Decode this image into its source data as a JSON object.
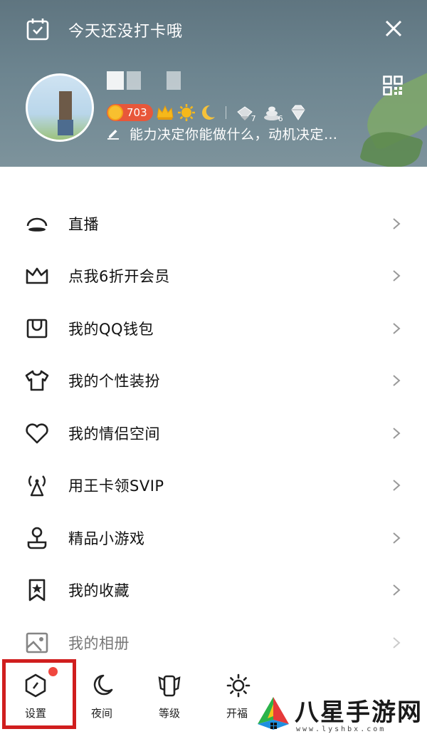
{
  "header": {
    "checkin_text": "今天还没打卡哦",
    "level_number": "703",
    "signature": "能力决定你能做什么，动机决定…",
    "badge_counts": [
      "7",
      "6"
    ]
  },
  "menu": {
    "items": [
      {
        "label": "直播",
        "icon": "live-icon"
      },
      {
        "label": "点我6折开会员",
        "icon": "crown-icon"
      },
      {
        "label": "我的QQ钱包",
        "icon": "wallet-icon"
      },
      {
        "label": "我的个性装扮",
        "icon": "tshirt-icon"
      },
      {
        "label": "我的情侣空间",
        "icon": "heart-icon"
      },
      {
        "label": "用王卡领SVIP",
        "icon": "signal-tower-icon"
      },
      {
        "label": "精品小游戏",
        "icon": "joystick-icon"
      },
      {
        "label": "我的收藏",
        "icon": "bookmark-star-icon"
      },
      {
        "label": "我的相册",
        "icon": "photo-album-icon"
      }
    ]
  },
  "bottom_bar": {
    "tabs": [
      {
        "label": "设置",
        "icon": "settings-hexagon-icon"
      },
      {
        "label": "夜间",
        "icon": "moon-icon"
      },
      {
        "label": "等级",
        "icon": "level-badge-icon"
      },
      {
        "label": "开福",
        "icon": "sun-icon"
      }
    ]
  },
  "watermark": {
    "title": "八星手游网",
    "url": "www.lyshbx.com"
  },
  "colors": {
    "header_bg": "#6d8590",
    "accent_red": "#f0473f",
    "highlight_red": "#d01e1e",
    "level_pill": "#e8573a"
  }
}
